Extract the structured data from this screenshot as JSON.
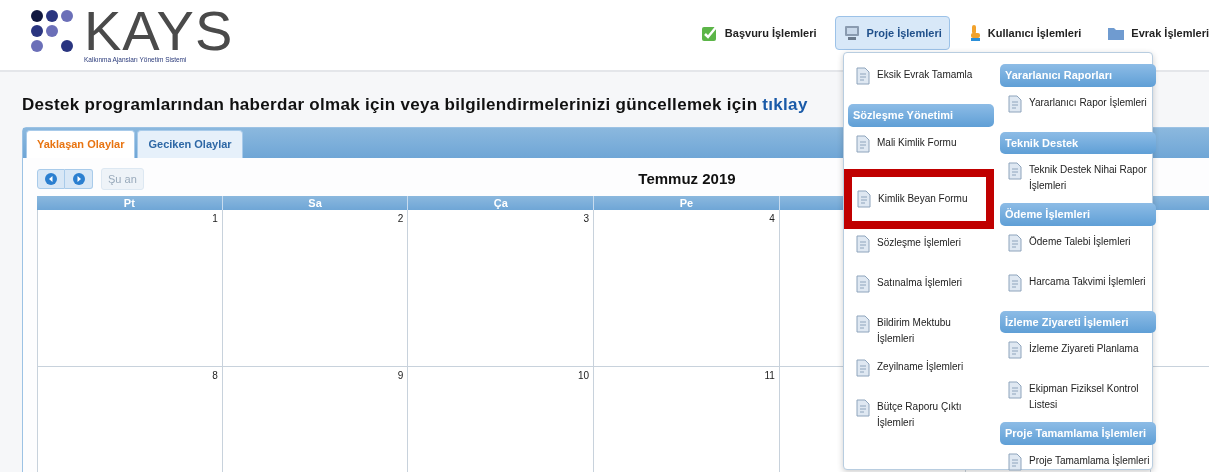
{
  "logo": {
    "title": "KAYS",
    "subtitle": "Kalkınma Ajansları Yönetim Sistemi"
  },
  "nav": [
    {
      "label": "Başvuru İşlemleri",
      "selected": false
    },
    {
      "label": "Proje İşlemleri",
      "selected": true
    },
    {
      "label": "Kullanıcı İşlemleri",
      "selected": false
    },
    {
      "label": "Evrak İşlemleri",
      "selected": false
    }
  ],
  "heading": {
    "text": "Destek programlarından haberdar olmak için veya bilgilendirmelerinizi güncellemek için",
    "link": "tıklay"
  },
  "tabs": [
    {
      "label": "Yaklaşan Olaylar",
      "selected": true
    },
    {
      "label": "Geciken Olaylar",
      "selected": false
    }
  ],
  "calendar": {
    "today_button": "Şu an",
    "title": "Temmuz 2019",
    "days": [
      "Pt",
      "Sa",
      "Ça",
      "Pe"
    ],
    "weeks": [
      [
        "1",
        "2",
        "3",
        "4"
      ],
      [
        "8",
        "9",
        "10",
        "11"
      ]
    ]
  },
  "menu": {
    "columns": [
      [
        {
          "kind": "item",
          "label": "Eksik Evrak Tamamla",
          "highlighted": false
        },
        {
          "kind": "header",
          "label": "Sözleşme Yönetimi"
        },
        {
          "kind": "item",
          "label": "Mali Kimlik Formu",
          "highlighted": false
        },
        {
          "kind": "item",
          "label": "Kimlik Beyan Formu",
          "highlighted": true
        },
        {
          "kind": "item",
          "label": "Sözleşme İşlemleri",
          "highlighted": false
        },
        {
          "kind": "item",
          "label": "Satınalma İşlemleri",
          "highlighted": false
        },
        {
          "kind": "item",
          "label": "Bildirim Mektubu İşlemleri",
          "highlighted": false
        },
        {
          "kind": "item",
          "label": "Zeyilname İşlemleri",
          "highlighted": false
        },
        {
          "kind": "item",
          "label": "Bütçe Raporu Çıktı İşlemleri",
          "highlighted": false
        }
      ],
      [
        {
          "kind": "header",
          "label": "Yararlanıcı Raporları"
        },
        {
          "kind": "item",
          "label": "Yararlanıcı Rapor İşlemleri",
          "highlighted": false
        },
        {
          "kind": "header",
          "label": "Teknik Destek"
        },
        {
          "kind": "item",
          "label": "Teknik Destek Nihai Rapor İşlemleri",
          "highlighted": false
        },
        {
          "kind": "header",
          "label": "Ödeme İşlemleri"
        },
        {
          "kind": "item",
          "label": "Ödeme Talebi İşlemleri",
          "highlighted": false
        },
        {
          "kind": "item",
          "label": "Harcama Takvimi İşlemleri",
          "highlighted": false
        },
        {
          "kind": "header",
          "label": "İzleme Ziyareti İşlemleri"
        },
        {
          "kind": "item",
          "label": "İzleme Ziyareti Planlama",
          "highlighted": false
        },
        {
          "kind": "item",
          "label": "Ekipman Fiziksel Kontrol Listesi",
          "highlighted": false
        },
        {
          "kind": "header",
          "label": "Proje Tamamlama İşlemleri"
        },
        {
          "kind": "item",
          "label": "Proje Tamamlama İşlemleri",
          "highlighted": false
        }
      ]
    ]
  }
}
